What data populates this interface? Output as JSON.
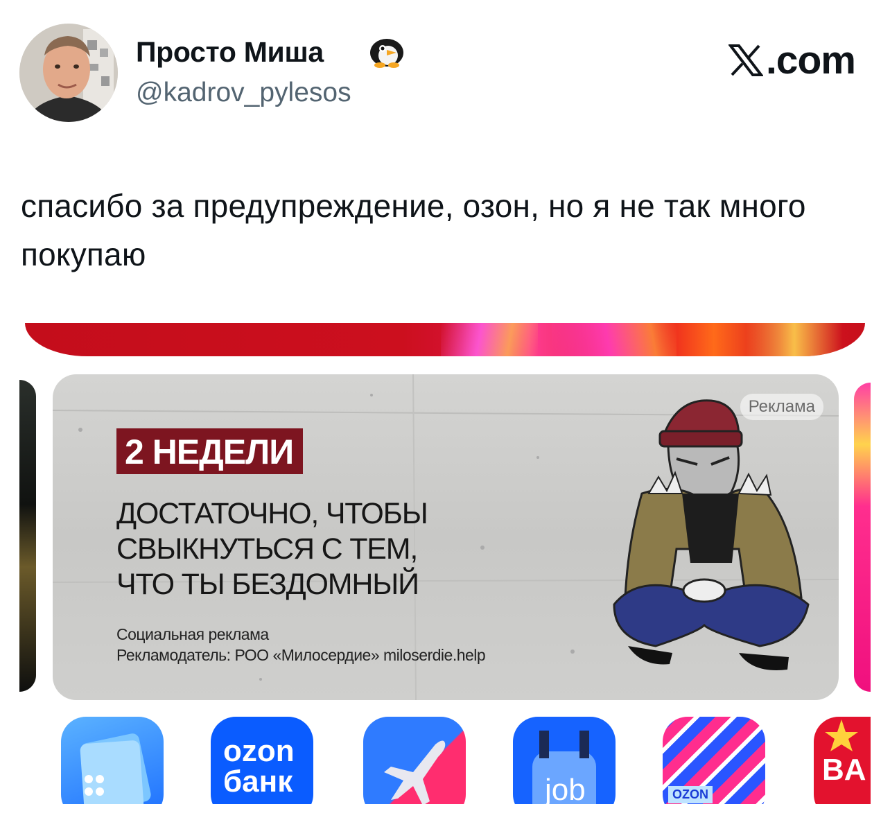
{
  "author": {
    "name": "Просто Миша",
    "handle": "@kadrov_pylesos",
    "badge_icon": "penguin-emoji"
  },
  "site": {
    "brand": ".com",
    "logo_icon": "x-logo"
  },
  "tweet": {
    "text": "спасибо за предупреждение, озон, но я не так много покупаю"
  },
  "ad": {
    "label": "Реклама",
    "badge": "2 НЕДЕЛИ",
    "headline": "ДОСТАТОЧНО, ЧТОБЫ\nСВЫКНУТЬСЯ С ТЕМ,\nЧТО ТЫ БЕЗДОМНЫЙ",
    "sub1": "Социальная реклама",
    "sub2": "Рекламодатель: РОО «Милосердие» miloserdie.help",
    "illustration": "homeless-man-illustration"
  },
  "apps": [
    {
      "name": "app-blue-cards",
      "label": ""
    },
    {
      "name": "ozon-bank",
      "label_line1": "ozon",
      "label_line2": "банк",
      "color": "#0a5cff"
    },
    {
      "name": "ozon-travel",
      "label": "",
      "color": "#2f7bff"
    },
    {
      "name": "ozon-job",
      "label": "job",
      "color": "#1663ff"
    },
    {
      "name": "ozon-app",
      "label": "OZON",
      "color": "#2a55ff"
    },
    {
      "name": "app-partial",
      "label": "BA",
      "color": "#e3122e"
    }
  ],
  "colors": {
    "badge_bg": "#7d1520",
    "handle_gray": "#536471",
    "ozon_blue": "#0a5cff"
  }
}
